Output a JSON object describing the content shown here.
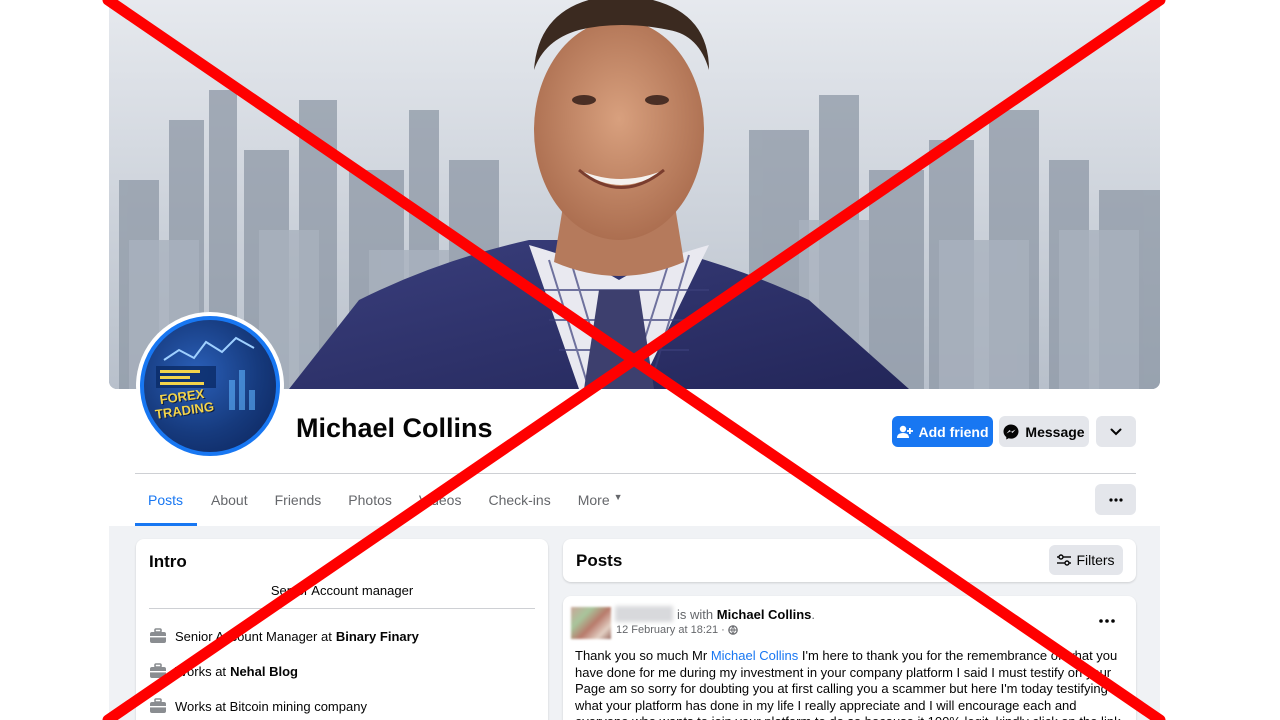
{
  "profile": {
    "name": "Michael Collins",
    "avatar_text": "FOREX TRADING"
  },
  "actions": {
    "add_friend": "Add friend",
    "message": "Message"
  },
  "tabs": [
    {
      "label": "Posts",
      "active": true
    },
    {
      "label": "About"
    },
    {
      "label": "Friends"
    },
    {
      "label": "Photos"
    },
    {
      "label": "Videos"
    },
    {
      "label": "Check-ins"
    },
    {
      "label": "More"
    }
  ],
  "intro": {
    "title": "Intro",
    "bio": "Senior Account manager",
    "items": [
      {
        "icon": "briefcase-icon",
        "prefix": "Senior Account Manager at",
        "bold": "Binary Finary"
      },
      {
        "icon": "briefcase-icon",
        "prefix": "Works at",
        "bold": "Nehal Blog"
      },
      {
        "icon": "briefcase-icon",
        "prefix": "Works at Bitcoin mining company",
        "bold": ""
      }
    ]
  },
  "posts": {
    "title": "Posts",
    "filters_label": "Filters",
    "post": {
      "with_text": "is with",
      "with_name": "Michael Collins",
      "with_suffix": ".",
      "date": "12 February at 18:21 ·",
      "body_prefix": "Thank you so much Mr",
      "body_mention": "Michael Collins",
      "body_rest": "I'm here to thank you for the remembrance of what you have done for me during my investment in your company platform I said I must testify on your Page am so sorry for doubting you at first calling you a scammer but here I'm today testifying what your platform has done in my life I really appreciate and I will encourage each and everyone who wants to join your platform to do so because it 100% legit, kindly click on the link to"
    }
  },
  "colors": {
    "accent": "#1877f2",
    "cross": "#ff0000",
    "feed_bg": "#f0f2f5"
  }
}
